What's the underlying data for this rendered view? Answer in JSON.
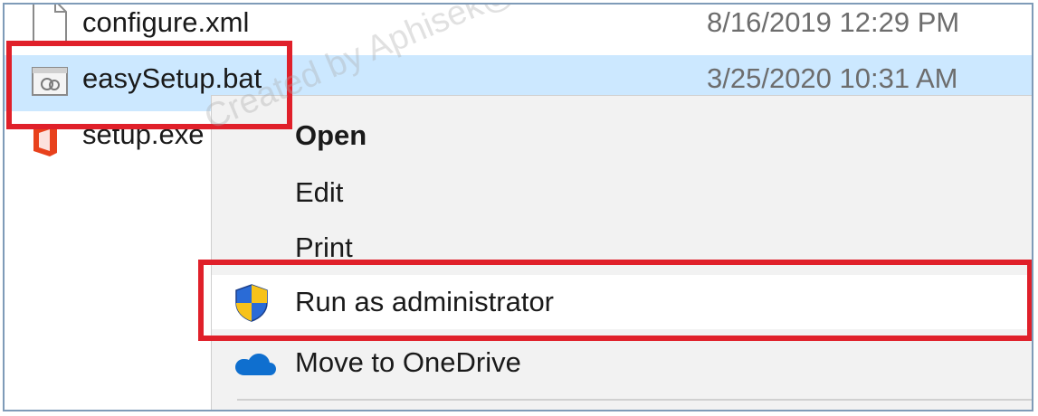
{
  "files": [
    {
      "name": "configure.xml",
      "date": "8/16/2019 12:29 PM",
      "icon": "xml-file-icon"
    },
    {
      "name": "easySetup.bat",
      "date": "3/25/2020 10:31 AM",
      "icon": "batch-file-icon",
      "selected": true
    },
    {
      "name": "setup.exe",
      "date": "",
      "icon": "office-setup-icon"
    }
  ],
  "context_menu": {
    "items": [
      {
        "label": "Open",
        "default": true
      },
      {
        "label": "Edit"
      },
      {
        "label": "Print"
      },
      {
        "label": "Run as administrator",
        "icon": "uac-shield-icon"
      },
      {
        "label": "Move to OneDrive",
        "icon": "onedrive-cloud-icon"
      }
    ]
  },
  "watermark": "Created by Aphisek@NETWORK",
  "colors": {
    "selection": "#cce8ff",
    "highlight_box": "#e0202a",
    "menu_bg": "#f2f2f2"
  }
}
